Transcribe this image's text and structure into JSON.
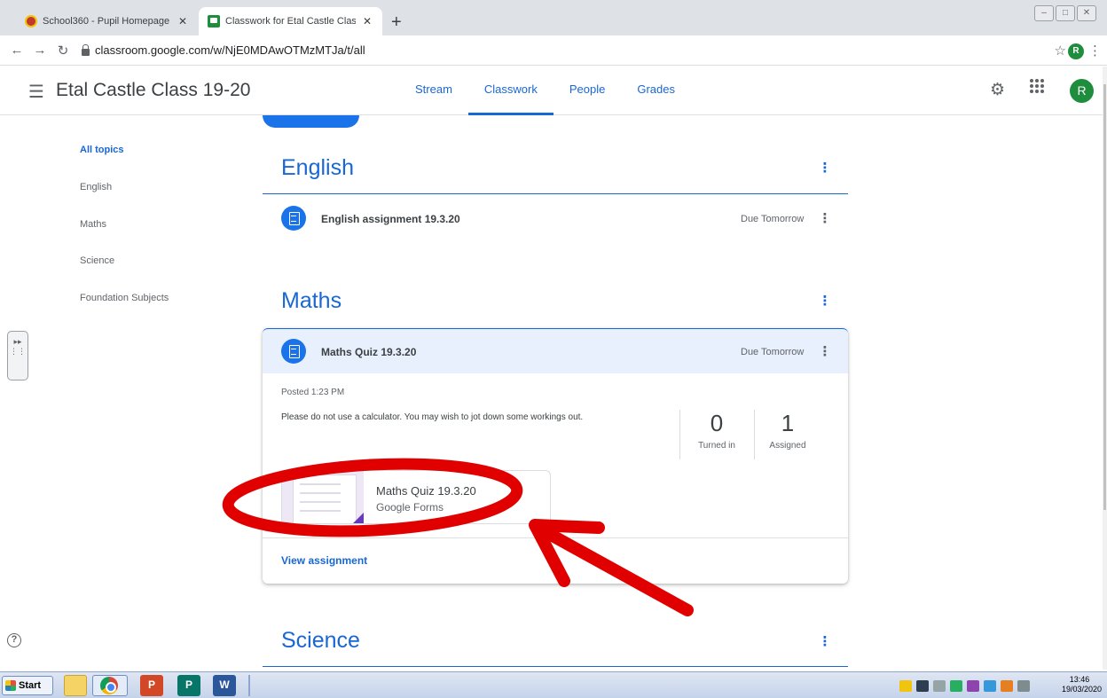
{
  "browser": {
    "tabs": [
      {
        "title": "School360 - Pupil Homepage",
        "favicon": "school360-icon",
        "active": false
      },
      {
        "title": "Classwork for Etal Castle Class 19-2",
        "favicon": "classroom-icon",
        "active": true
      }
    ],
    "url": "classroom.google.com/w/NjE0MDAwOTMzMTJa/t/all",
    "profile_initial": "R"
  },
  "header": {
    "class_name": "Etal Castle Class 19-20",
    "tabs": [
      "Stream",
      "Classwork",
      "People",
      "Grades"
    ],
    "selected_tab": "Classwork",
    "profile_initial": "R"
  },
  "sidebar": {
    "topics": [
      "All topics",
      "English",
      "Maths",
      "Science",
      "Foundation Subjects"
    ],
    "selected": "All topics"
  },
  "sections": {
    "english": {
      "title": "English",
      "assignment_title": "English assignment 19.3.20",
      "due": "Due Tomorrow"
    },
    "maths": {
      "title": "Maths",
      "assignment_title": "Maths Quiz 19.3.20",
      "due": "Due Tomorrow",
      "posted": "Posted 1:23 PM",
      "instructions": "Please do not use a calculator. You may wish to jot down some workings out.",
      "turned_in_count": "0",
      "turned_in_label": "Turned in",
      "assigned_count": "1",
      "assigned_label": "Assigned",
      "attachment_title": "Maths Quiz 19.3.20",
      "attachment_type": "Google Forms",
      "view_link": "View assignment"
    },
    "science": {
      "title": "Science"
    }
  },
  "taskbar": {
    "start_label": "Start",
    "time": "13:46",
    "date": "19/03/2020"
  },
  "colors": {
    "accent": "#1967d2",
    "brand_green": "#1e8e3e",
    "annotation_red": "#e00000"
  }
}
